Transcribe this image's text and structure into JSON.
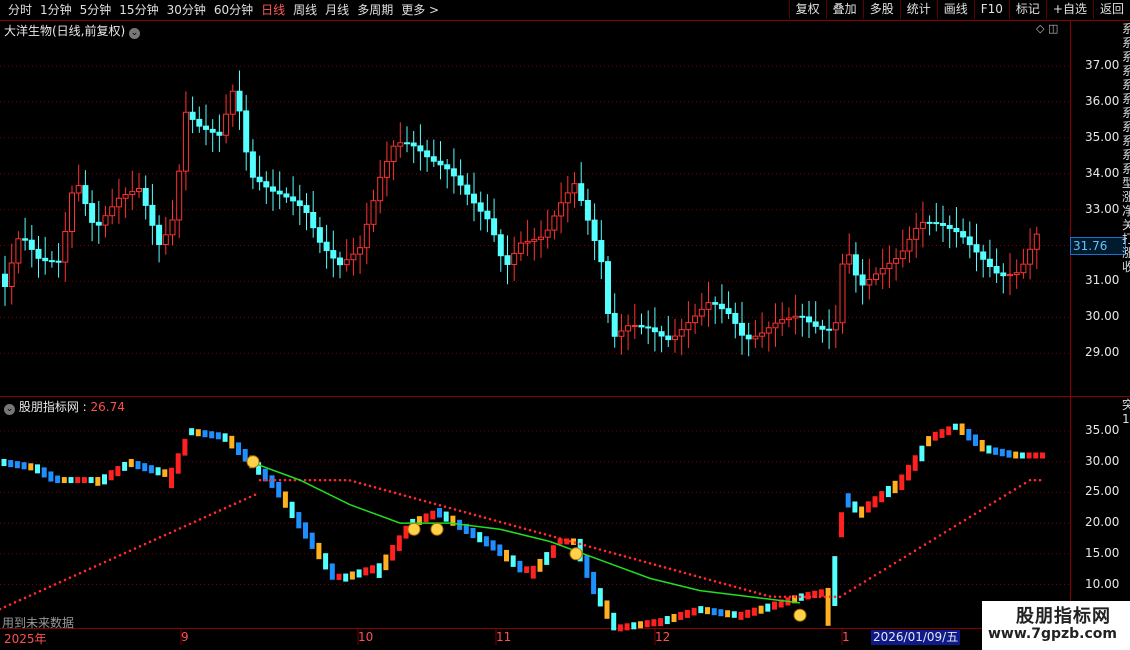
{
  "toolbar": {
    "periods": [
      "分时",
      "1分钟",
      "5分钟",
      "15分钟",
      "30分钟",
      "60分钟",
      "日线",
      "周线",
      "月线",
      "多周期",
      "更多 >"
    ],
    "active_period": "日线",
    "buttons": [
      "复权",
      "叠加",
      "多股",
      "统计",
      "画线",
      "F10",
      "标记",
      "+自选",
      "返回"
    ]
  },
  "main_chart": {
    "title": "大洋生物(日线,前复权)",
    "price_axis": [
      "37.00",
      "36.00",
      "35.00",
      "34.00",
      "33.00",
      "32.00",
      "31.00",
      "30.00",
      "29.00"
    ],
    "current_price": "31.76"
  },
  "indicator": {
    "name": "股朋指标网",
    "value": "26.74",
    "axis": [
      "35.00",
      "30.00",
      "25.00",
      "20.00",
      "15.00",
      "10.00"
    ],
    "future_note": "用到未来数据"
  },
  "time_axis": {
    "labels": [
      "2025年",
      "9",
      "10",
      "11",
      "12",
      "1"
    ],
    "cursor_date": "2026/01/09/五"
  },
  "watermark": {
    "line1": "股朋指标网",
    "line2": "www.7gpzb.com"
  },
  "colors": {
    "up": "#ff3232",
    "down": "#54ffff",
    "grid": "#7a0000",
    "ma": "#22dd22"
  }
}
